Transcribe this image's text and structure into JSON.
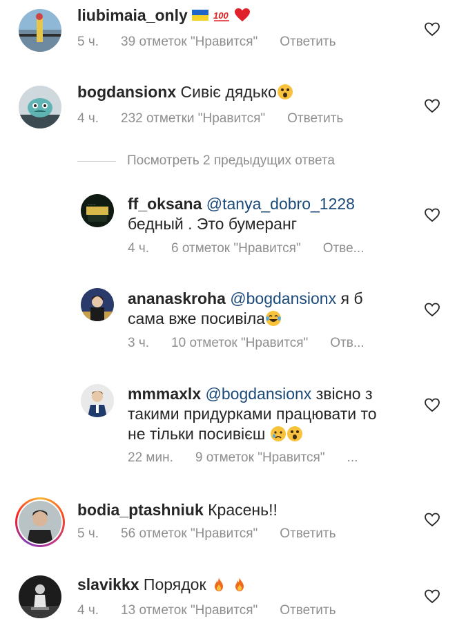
{
  "comments": [
    {
      "username": "liubimaia_only",
      "text": "",
      "emojis": [
        "flag-ukraine",
        "hundred-points",
        "red-heart"
      ],
      "time": "5 ч.",
      "likes": "39 отметок \"Нравится\"",
      "reply": "Ответить"
    },
    {
      "username": "bogdansionx",
      "text": "Сивіє дядько",
      "emojis": [
        "astonished-face"
      ],
      "time": "4 ч.",
      "likes": "232 отметки \"Нравится\"",
      "reply": "Ответить"
    }
  ],
  "view_previous": "Посмотреть 2 предыдущих ответа",
  "replies": [
    {
      "username": "ff_oksana",
      "mention": "@tanya_dobro_1228",
      "line1_rest": "",
      "line2": "бедный . Это бумеранг",
      "time": "4 ч.",
      "likes": "6 отметок \"Нравится\"",
      "reply": "Отве..."
    },
    {
      "username": "ananaskroha",
      "mention": "@bogdansionx",
      "line1_rest": "я б",
      "line2": "сама вже посивіла",
      "emojis": [
        "tears-of-joy-face"
      ],
      "time": "3 ч.",
      "likes": "10 отметок \"Нравится\"",
      "reply": "Отв..."
    },
    {
      "username": "mmmaxlx",
      "mention": "@bogdansionx",
      "line1_rest": "звісно з",
      "line2": "такими придурками працювати то",
      "line3": "не тільки посивієш",
      "emojis": [
        "crying-face",
        "astonished-face"
      ],
      "time": "22 мин.",
      "likes": "9 отметок \"Нравится\"",
      "reply": "..."
    }
  ],
  "bottom_comments": [
    {
      "username": "bodia_ptashniuk",
      "text": "Красень!!",
      "time": "5 ч.",
      "likes": "56 отметок \"Нравится\"",
      "reply": "Ответить"
    },
    {
      "username": "slavikkx",
      "text": "Порядок",
      "emojis": [
        "fire",
        "fire"
      ],
      "time": "4 ч.",
      "likes": "13 отметок \"Нравится\"",
      "reply": "Ответить"
    }
  ],
  "colors": {
    "text": "#262626",
    "meta": "#8e8e8e",
    "mention": "#1b4a7a",
    "story_ring": "#c13584"
  }
}
